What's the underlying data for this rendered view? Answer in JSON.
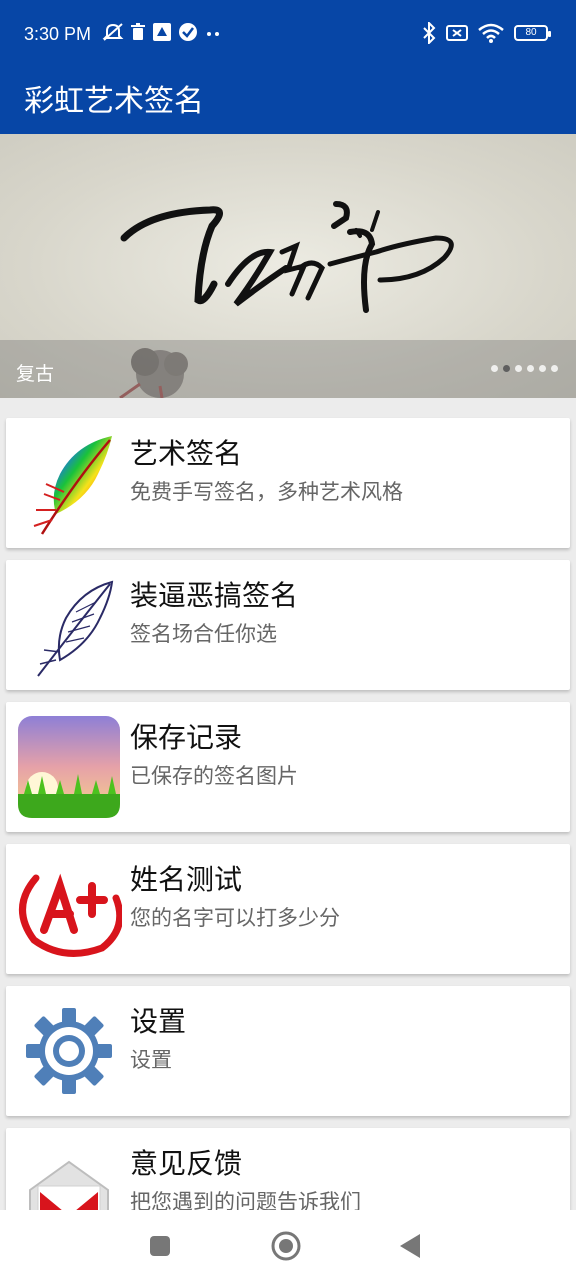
{
  "status_bar": {
    "time": "3:30 PM",
    "battery_level": "80",
    "left_icons": [
      "mute-icon",
      "trash-icon",
      "app-icon",
      "check-circle-icon",
      "more-dots-icon"
    ],
    "right_icons": [
      "bluetooth-icon",
      "signal-off-icon",
      "wifi-icon",
      "battery-icon"
    ]
  },
  "app_bar": {
    "title": "彩虹艺术签名"
  },
  "banner": {
    "caption": "复古",
    "page_count": 6,
    "active_page": 2
  },
  "menu": [
    {
      "title": "艺术签名",
      "subtitle": "免费手写签名，多种艺术风格",
      "icon": "rainbow-feather-icon"
    },
    {
      "title": "装逼恶搞签名",
      "subtitle": "签名场合任你选",
      "icon": "quill-feather-icon"
    },
    {
      "title": "保存记录",
      "subtitle": "已保存的签名图片",
      "icon": "sunset-grass-icon"
    },
    {
      "title": "姓名测试",
      "subtitle": "您的名字可以打多少分",
      "icon": "a-plus-grade-icon"
    },
    {
      "title": "设置",
      "subtitle": "设置",
      "icon": "gear-icon"
    },
    {
      "title": "意见反馈",
      "subtitle": "把您遇到的问题告诉我们",
      "icon": "gmail-envelope-icon"
    }
  ],
  "nav_bar": {
    "buttons": [
      "recents-button",
      "home-button",
      "back-button"
    ]
  },
  "colors": {
    "primary": "#0746a6",
    "background": "#ececec",
    "card": "#ffffff",
    "subtitle": "#666666"
  }
}
